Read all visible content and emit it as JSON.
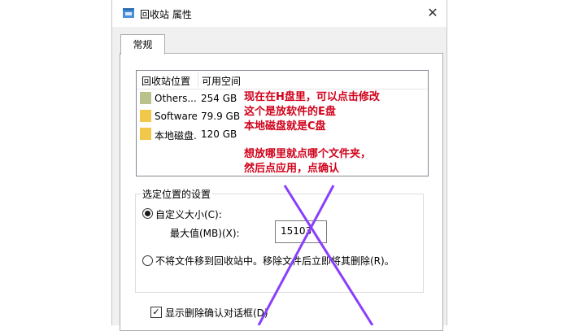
{
  "window": {
    "title": "回收站 属性",
    "close_glyph": "✕"
  },
  "tabs": [
    {
      "label": "常规"
    }
  ],
  "location_list": {
    "columns": [
      "回收站位置",
      "可用空间"
    ],
    "rows": [
      {
        "name": "Others...",
        "space": "254 GB",
        "color": "#b8c28a"
      },
      {
        "name": "Software...",
        "space": "79.9 GB",
        "color": "#f2c84b"
      },
      {
        "name": "本地磁盘...",
        "space": "120 GB",
        "color": "#f2c84b"
      }
    ]
  },
  "annotations": {
    "line1": "现在在H盘里，可以点击修改",
    "line2": "这个是放软件的E盘",
    "line3": "本地磁盘就是C盘",
    "line4": "想放哪里就点哪个文件夹，",
    "line5": "然后点应用，点确认",
    "text_color": "#d0021b",
    "cross_color": "#8a3ffc"
  },
  "settings": {
    "group_title": "选定位置的设置",
    "custom_size_label": "自定义大小(C):",
    "custom_size_selected": true,
    "max_value_label": "最大值(MB)(X):",
    "max_value": "15103",
    "no_recycle_label": "不将文件移到回收站中。移除文件后立即将其删除(R)。",
    "no_recycle_selected": false,
    "confirm_dialog_label": "显示删除确认对话框(D)",
    "confirm_dialog_checked": true,
    "check_glyph": "✓"
  }
}
